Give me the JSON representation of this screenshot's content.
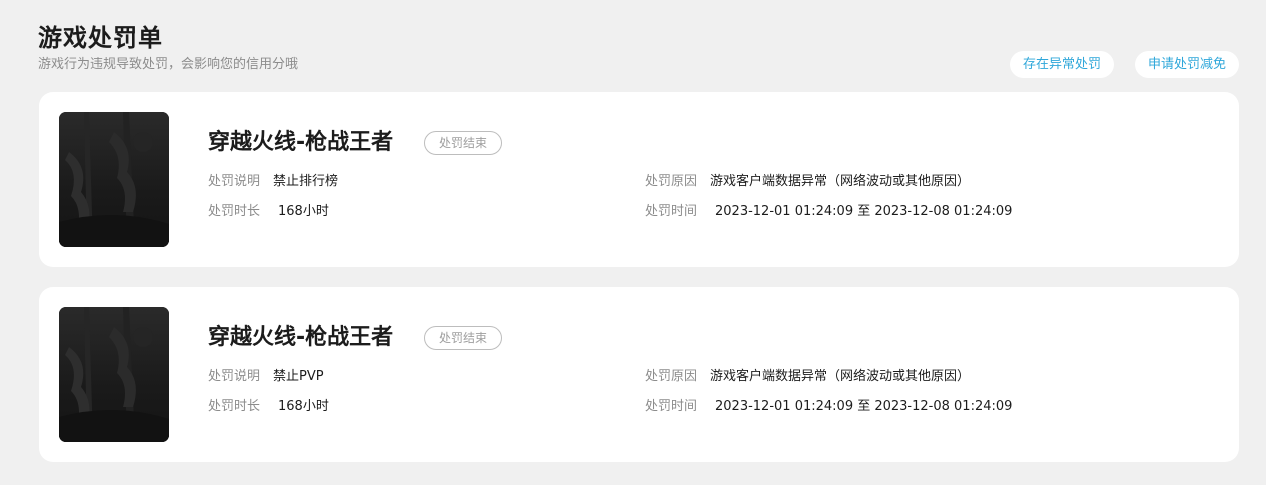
{
  "header": {
    "title": "游戏处罚单",
    "subtitle": "游戏行为违规导致处罚，会影响您的信用分哦"
  },
  "actions": {
    "report_abnormal_label": "存在异常处罚",
    "apply_reduction_label": "申请处罚减免"
  },
  "records": [
    {
      "game_name": "穿越火线-枪战王者",
      "status": "处罚结束",
      "desc_label": "处罚说明",
      "desc_value": "禁止排行榜",
      "duration_label": "处罚时长",
      "duration_value": "168小时",
      "reason_label": "处罚原因",
      "reason_value": "游戏客户端数据异常（网络波动或其他原因）",
      "time_label": "处罚时间",
      "time_value": "2023-12-01 01:24:09 至 2023-12-08 01:24:09"
    },
    {
      "game_name": "穿越火线-枪战王者",
      "status": "处罚结束",
      "desc_label": "处罚说明",
      "desc_value": "禁止PVP",
      "duration_label": "处罚时长",
      "duration_value": "168小时",
      "reason_label": "处罚原因",
      "reason_value": "游戏客户端数据异常（网络波动或其他原因）",
      "time_label": "处罚时间",
      "time_value": "2023-12-01 01:24:09 至 2023-12-08 01:24:09"
    }
  ],
  "colors": {
    "page_bg": "#f0f0f0",
    "card_bg": "#ffffff",
    "accent": "#2fa7da",
    "muted": "#8c8c8c",
    "status_border": "#bdbdbd"
  }
}
